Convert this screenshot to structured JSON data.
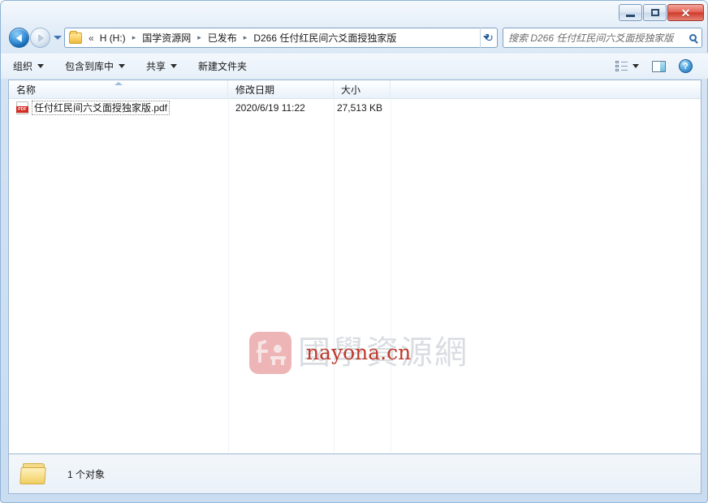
{
  "window": {
    "controls": {
      "minimize_label": "–",
      "maximize_label": "□",
      "close_label": "✕"
    }
  },
  "navigation": {
    "back_title": "后退",
    "forward_title": "前进",
    "recent_pages_title": "最近浏览的页面"
  },
  "address": {
    "double_chevron": "«",
    "separator": "▸",
    "crumbs": [
      "H (H:)",
      "国学资源网",
      "已发布",
      "D266 任付红民间六爻面授独家版"
    ],
    "refresh_label": "↻"
  },
  "search": {
    "placeholder": "搜索 D266 任付红民间六爻面授独家版"
  },
  "toolbar": {
    "items": [
      {
        "label": "组织",
        "has_caret": true
      },
      {
        "label": "包含到库中",
        "has_caret": true
      },
      {
        "label": "共享",
        "has_caret": true
      },
      {
        "label": "新建文件夹",
        "has_caret": false
      }
    ],
    "view_options_title": "更改视图",
    "preview_pane_title": "显示预览窗格",
    "help_title": "获取帮助",
    "help_label": "?"
  },
  "columns": [
    {
      "key": "name",
      "label": "名称",
      "sorted": "asc"
    },
    {
      "key": "date",
      "label": "修改日期",
      "sorted": ""
    },
    {
      "key": "size",
      "label": "大小",
      "sorted": ""
    },
    {
      "key": "rest",
      "label": "",
      "sorted": ""
    }
  ],
  "files": [
    {
      "icon": "pdf-file-icon",
      "name": "任付红民间六爻面授独家版.pdf",
      "date": "2020/6/19 11:22",
      "size": "27,513 KB",
      "focused": true
    }
  ],
  "watermark": {
    "seal": "nayona-seal-logo",
    "site_name_cn": "國學資源網",
    "site_url": "nayona.cn",
    "text_color": "#d9dde2",
    "url_color": "#c0392b",
    "seal_color": "#edadb0"
  },
  "statusbar": {
    "folder_icon": "folder-icon",
    "summary": "1 个对象"
  },
  "colors": {
    "frame": "#cfe0f2",
    "accent": "#1364ae",
    "close_button": "#cf3b2c",
    "list_background": "#ffffff"
  }
}
